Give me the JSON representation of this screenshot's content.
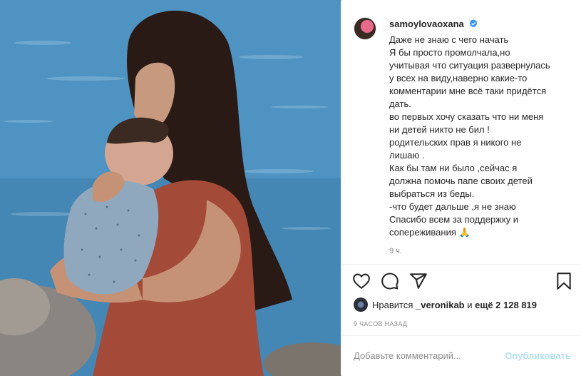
{
  "post": {
    "username": "samoylovaoxana",
    "verified_icon": "verified-badge-icon",
    "caption_lines": [
      "Даже не знаю с чего начать",
      "Я бы просто промолчала,но",
      "учитывая что ситуация развернулась",
      "у всех на виду,наверно какие-то",
      "комментарии мне всё таки придётся",
      "дать.",
      "во первых хочу сказать что ни меня",
      "ни детей никто не бил !",
      "родительских прав я никого не",
      "лишаю .",
      "Как бы там ни было ,сейчас я",
      "должна помочь папе своих детей",
      "выбраться из беды.",
      "-что будет дальше ,я не знаю",
      "Спасибо всем за поддержку и",
      "сопереживания 🙏"
    ],
    "time_ago": "9 ч."
  },
  "actions": {
    "like_icon": "heart-icon",
    "comment_icon": "comment-icon",
    "share_icon": "paper-plane-icon",
    "save_icon": "bookmark-icon"
  },
  "likes": {
    "prefix": "Нравится ",
    "user": "_veronikab",
    "middle": " и ",
    "more": "ещё 2 128 819"
  },
  "date_label": "9 часов назад",
  "comment": {
    "placeholder": "Добавьте комментарий...",
    "publish_label": "Опубликовать"
  },
  "colors": {
    "accent_disabled": "#b2dffc",
    "verified": "#3897f0",
    "muted": "#8e8e8e"
  }
}
